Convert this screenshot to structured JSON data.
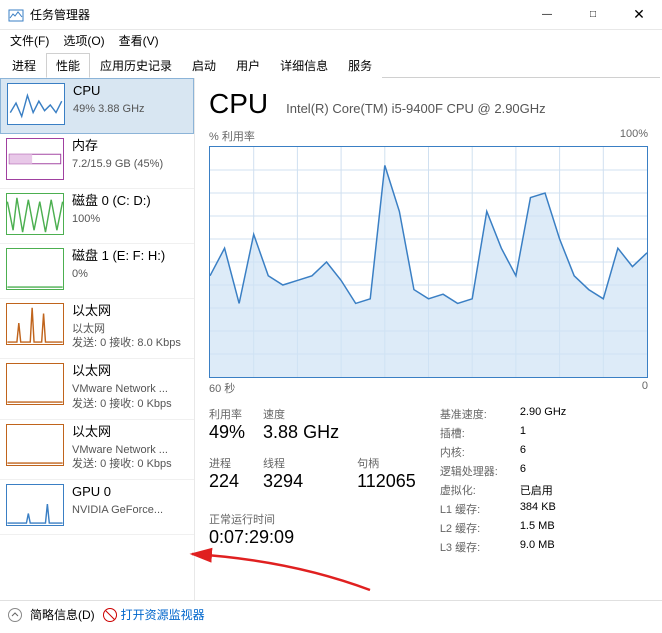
{
  "window": {
    "title": "任务管理器",
    "minimize": "—",
    "maximize": "□",
    "close": "✕"
  },
  "menu": {
    "file": "文件(F)",
    "options": "选项(O)",
    "view": "查看(V)"
  },
  "tabs": {
    "processes": "进程",
    "performance": "性能",
    "history": "应用历史记录",
    "startup": "启动",
    "users": "用户",
    "details": "详细信息",
    "services": "服务"
  },
  "sidebar": [
    {
      "title": "CPU",
      "sub1": "49% 3.88 GHz",
      "color": "#3a7fc4"
    },
    {
      "title": "内存",
      "sub1": "7.2/15.9 GB (45%)",
      "color": "#a040a0"
    },
    {
      "title": "磁盘 0 (C: D:)",
      "sub1": "100%",
      "color": "#4caf50"
    },
    {
      "title": "磁盘 1 (E: F: H:)",
      "sub1": "0%",
      "color": "#4caf50"
    },
    {
      "title": "以太网",
      "sub1": "以太网",
      "sub2": "发送: 0 接收: 8.0 Kbps",
      "color": "#c0641c"
    },
    {
      "title": "以太网",
      "sub1": "VMware Network ...",
      "sub2": "发送: 0 接收: 0 Kbps",
      "color": "#c0641c"
    },
    {
      "title": "以太网",
      "sub1": "VMware Network ...",
      "sub2": "发送: 0 接收: 0 Kbps",
      "color": "#c0641c"
    },
    {
      "title": "GPU 0",
      "sub1": "NVIDIA GeForce...",
      "color": "#3a7fc4"
    }
  ],
  "cpu": {
    "title": "CPU",
    "model": "Intel(R) Core(TM) i5-9400F CPU @ 2.90GHz",
    "chart_top_left": "% 利用率",
    "chart_top_right": "100%",
    "chart_bot_left": "60 秒",
    "chart_bot_right": "0"
  },
  "chart_data": {
    "type": "area",
    "title": "% 利用率",
    "xlabel": "60 秒",
    "ylabel": "",
    "ylim": [
      0,
      100
    ],
    "x_seconds": [
      60,
      58,
      56,
      54,
      52,
      50,
      48,
      46,
      44,
      42,
      40,
      38,
      36,
      34,
      32,
      30,
      28,
      26,
      24,
      22,
      20,
      18,
      16,
      14,
      12,
      10,
      8,
      6,
      4,
      2,
      0
    ],
    "values": [
      44,
      56,
      32,
      62,
      44,
      40,
      42,
      44,
      50,
      42,
      32,
      34,
      92,
      72,
      38,
      34,
      36,
      32,
      34,
      72,
      56,
      44,
      78,
      80,
      60,
      44,
      38,
      34,
      56,
      48,
      54
    ]
  },
  "stats_left": {
    "util_label": "利用率",
    "util": "49%",
    "speed_label": "速度",
    "speed": "3.88 GHz",
    "proc_label": "进程",
    "proc": "224",
    "thread_label": "线程",
    "thread": "3294",
    "handle_label": "句柄",
    "handle": "112065",
    "uptime_label": "正常运行时间",
    "uptime": "0:07:29:09"
  },
  "stats_right": [
    {
      "k": "基准速度:",
      "v": "2.90 GHz"
    },
    {
      "k": "插槽:",
      "v": "1"
    },
    {
      "k": "内核:",
      "v": "6"
    },
    {
      "k": "逻辑处理器:",
      "v": "6"
    },
    {
      "k": "虚拟化:",
      "v": "已启用"
    },
    {
      "k": "L1 缓存:",
      "v": "384 KB"
    },
    {
      "k": "L2 缓存:",
      "v": "1.5 MB"
    },
    {
      "k": "L3 缓存:",
      "v": "9.0 MB"
    }
  ],
  "footer": {
    "less": "简略信息(D)",
    "monitor": "打开资源监视器"
  }
}
